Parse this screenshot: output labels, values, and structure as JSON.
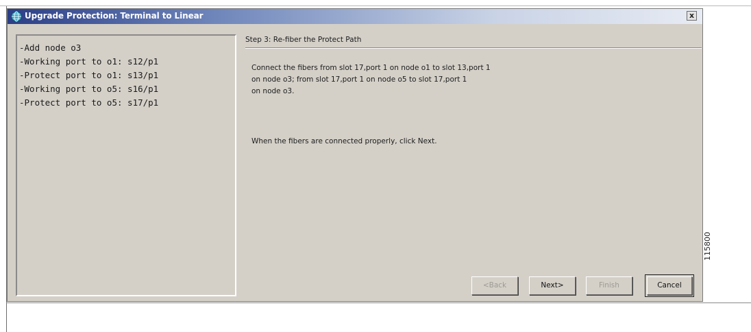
{
  "window": {
    "title": "Upgrade Protection: Terminal to Linear",
    "close_label": "x"
  },
  "summary": {
    "lines": [
      "-Add node o3",
      "-Working port to o1: s12/p1",
      "-Protect port to o1: s13/p1",
      "-Working port to o5: s16/p1",
      "-Protect port to o5: s17/p1"
    ]
  },
  "step": {
    "title": "Step 3: Re-fiber the Protect Path",
    "instructions": [
      "Connect the fibers from slot 17,port 1 on node o1 to slot 13,port 1",
      "on node o3; from slot 17,port 1 on node o5 to slot 17,port 1",
      "on node o3."
    ],
    "hint": "When the fibers are connected properly, click Next."
  },
  "buttons": {
    "back": "<Back",
    "next": "Next>",
    "finish": "Finish",
    "cancel": "Cancel"
  },
  "figure_id": "115800",
  "icons": {
    "app": "network-globe-icon",
    "close": "close-icon"
  },
  "colors": {
    "titlebar_start": "#2b3e86",
    "titlebar_end": "#e7ebf3",
    "dialog_face": "#d4d0c8",
    "disabled_text": "#9c9a94"
  }
}
